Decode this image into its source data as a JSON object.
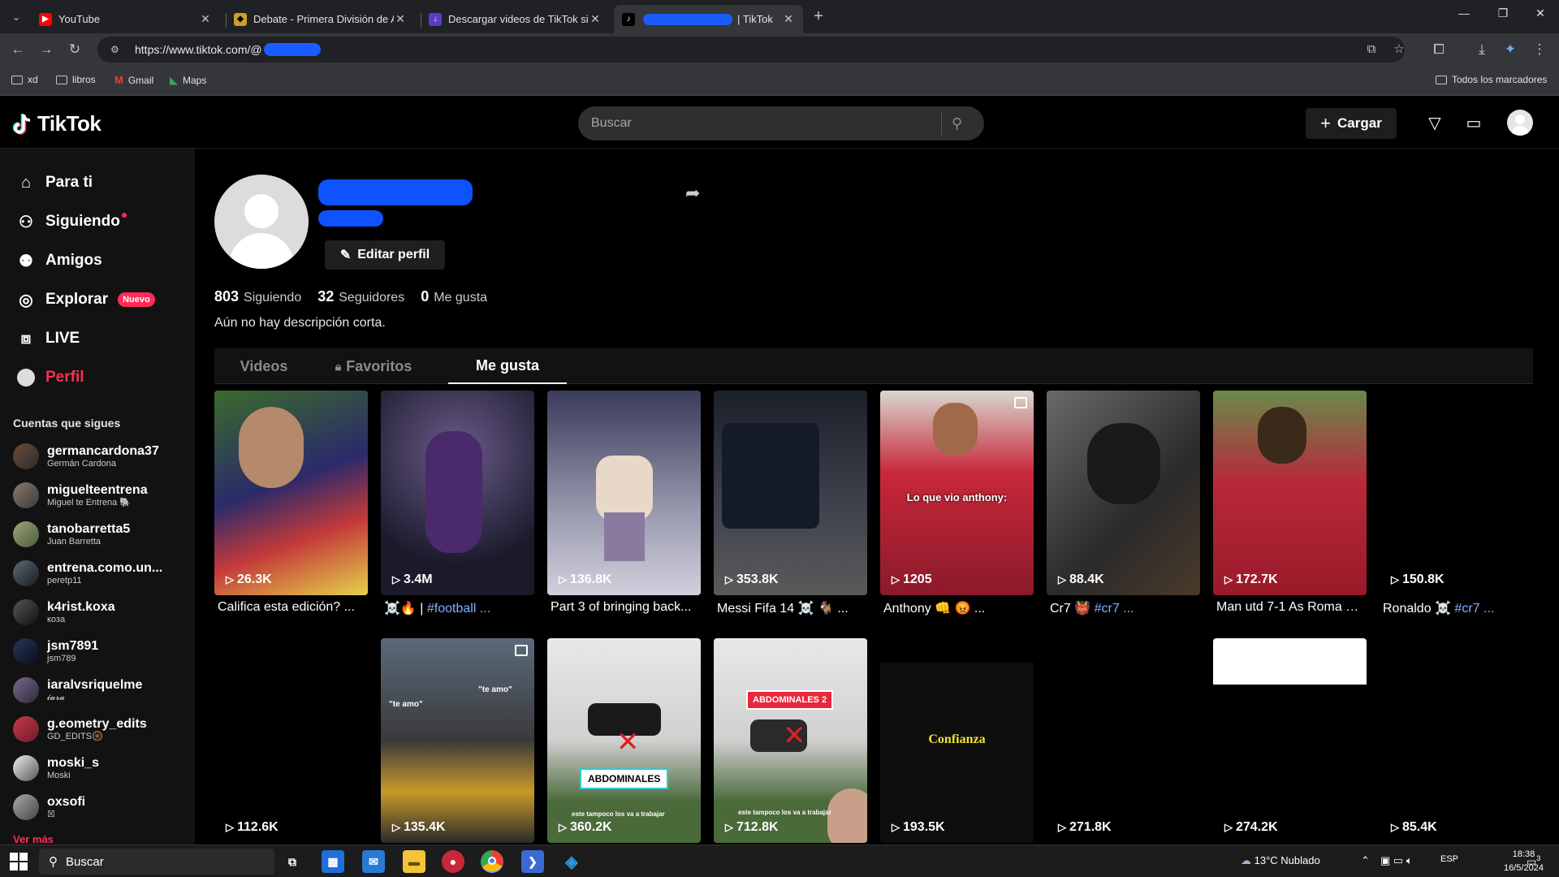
{
  "browser": {
    "tabs": [
      {
        "title": "YouTube",
        "favicon": "youtube-icon",
        "color": "#ff0000"
      },
      {
        "title": "Debate - Primera División de A...",
        "favicon": "shield-icon",
        "color": "#c9a227"
      },
      {
        "title": "Descargar videos de TikTok sin...",
        "favicon": "download-site-icon",
        "color": "#5b3cc4"
      },
      {
        "title": "| TikTok",
        "favicon": "tiktok-icon",
        "color": "#ffffff"
      }
    ],
    "url": "https://www.tiktok.com/@",
    "bookmarks": [
      {
        "label": "xd",
        "icon": "folder-icon"
      },
      {
        "label": "libros",
        "icon": "folder-icon"
      },
      {
        "label": "Gmail",
        "icon": "gmail-icon"
      },
      {
        "label": "Maps",
        "icon": "maps-icon"
      }
    ],
    "all_bookmarks": "Todos los marcadores"
  },
  "header": {
    "logo": "TikTok",
    "search_placeholder": "Buscar",
    "upload_label": "Cargar"
  },
  "sidebar": {
    "nav": [
      {
        "label": "Para ti",
        "icon": "home-icon"
      },
      {
        "label": "Siguiendo",
        "icon": "following-icon"
      },
      {
        "label": "Amigos",
        "icon": "friends-icon"
      },
      {
        "label": "Explorar",
        "icon": "compass-icon",
        "badge": "Nuevo"
      },
      {
        "label": "LIVE",
        "icon": "live-icon"
      },
      {
        "label": "Perfil",
        "icon": "profile-icon"
      }
    ],
    "following_heading": "Cuentas que sigues",
    "accounts": [
      {
        "name": "germancardona37",
        "sub": "Germán Cardona"
      },
      {
        "name": "miguelteentrena",
        "sub": "Miguel te Entrena 🐘"
      },
      {
        "name": "tanobarretta5",
        "sub": "Juan Barretta"
      },
      {
        "name": "entrena.como.un...",
        "sub": "peretp11"
      },
      {
        "name": "k4rist.koxa",
        "sub": "коза"
      },
      {
        "name": "jsm7891",
        "sub": "jsm789"
      },
      {
        "name": "iaralvsriquelme",
        "sub": "𝓲𝓪𝓻𝓪"
      },
      {
        "name": "g.eometry_edits",
        "sub": "GD_EDITS🛞"
      },
      {
        "name": "moski_s",
        "sub": "Moski"
      },
      {
        "name": "oxsofi",
        "sub": "☒"
      }
    ],
    "see_more": "Ver más"
  },
  "profile": {
    "edit_label": "Editar perfil",
    "following_count": "803",
    "following_label": "Siguiendo",
    "followers_count": "32",
    "followers_label": "Seguidores",
    "likes_count": "0",
    "likes_label": "Me gusta",
    "bio": "Aún no hay descripción corta.",
    "tabs": [
      "Videos",
      "Favoritos",
      "Me gusta"
    ]
  },
  "videos": [
    {
      "views": "26.3K",
      "caption": "Califica esta edición? ..."
    },
    {
      "views": "3.4M",
      "caption": "☠️🔥 | ",
      "hashtag": "#football ..."
    },
    {
      "views": "136.8K",
      "caption": "Part 3 of bringing back..."
    },
    {
      "views": "353.8K",
      "caption": "Messi Fifa 14 ☠️ 🐐 ..."
    },
    {
      "views": "1205",
      "caption": "Anthony 👊 😡 ...",
      "overlay": "Lo que vio anthony:"
    },
    {
      "views": "88.4K",
      "caption": "Cr7 👹 ",
      "hashtag": "#cr7 ..."
    },
    {
      "views": "172.7K",
      "caption": "Man utd 7-1 As Roma 2..."
    },
    {
      "views": "150.8K",
      "caption": "Ronaldo ☠️ ",
      "hashtag": "#cr7 ..."
    },
    {
      "views": "112.6K"
    },
    {
      "views": "135.4K",
      "overlay": "\"te amo\"",
      "overlay2": "\"te amo\""
    },
    {
      "views": "360.2K",
      "overlay": "ABDOMINALES",
      "overlay2": "este tampoco los va a trabajar"
    },
    {
      "views": "712.8K",
      "overlay": "ABDOMINALES 2",
      "overlay2": "este tampoco los va a trabajar"
    },
    {
      "views": "193.5K",
      "overlay": "Confianza"
    },
    {
      "views": "271.8K"
    },
    {
      "views": "274.2K"
    },
    {
      "views": "85.4K"
    }
  ],
  "taskbar": {
    "search_placeholder": "Buscar",
    "weather": "13°C  Nublado",
    "lang": "ESP",
    "time": "18:38",
    "date": "16/5/2024",
    "notifications": "3"
  }
}
